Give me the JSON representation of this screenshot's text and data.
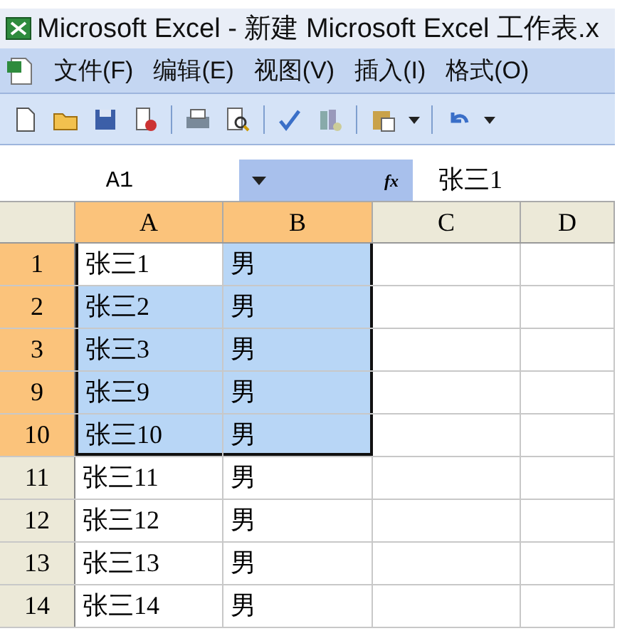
{
  "window": {
    "title": "Microsoft Excel - 新建 Microsoft Excel 工作表.x"
  },
  "menu": [
    {
      "label": "文件(F)"
    },
    {
      "label": "编辑(E)"
    },
    {
      "label": "视图(V)"
    },
    {
      "label": "插入(I)"
    },
    {
      "label": "格式(O)"
    }
  ],
  "toolbar": [
    {
      "kind": "new"
    },
    {
      "kind": "open"
    },
    {
      "kind": "save"
    },
    {
      "kind": "permission"
    },
    {
      "kind": "sep"
    },
    {
      "kind": "print"
    },
    {
      "kind": "preview"
    },
    {
      "kind": "sep"
    },
    {
      "kind": "spelling"
    },
    {
      "kind": "research"
    },
    {
      "kind": "sep"
    },
    {
      "kind": "paste"
    },
    {
      "kind": "dropdown"
    },
    {
      "kind": "sep"
    },
    {
      "kind": "undo"
    },
    {
      "kind": "dropdown"
    }
  ],
  "formula_bar": {
    "name_box": "A1",
    "fx": "fx",
    "value": "张三1"
  },
  "columns": [
    {
      "label": "A",
      "selected": true
    },
    {
      "label": "B",
      "selected": true
    },
    {
      "label": "C",
      "selected": false
    },
    {
      "label": "D",
      "selected": false
    }
  ],
  "rows": [
    {
      "header": "1",
      "selected": true,
      "cells": [
        {
          "text": "张三1",
          "active": true
        },
        {
          "text": "男",
          "active": false
        }
      ]
    },
    {
      "header": "2",
      "selected": true,
      "cells": [
        {
          "text": "张三2",
          "active": false
        },
        {
          "text": "男",
          "active": false
        }
      ]
    },
    {
      "header": "3",
      "selected": true,
      "cells": [
        {
          "text": "张三3",
          "active": false
        },
        {
          "text": "男",
          "active": false
        }
      ]
    },
    {
      "header": "9",
      "selected": true,
      "cells": [
        {
          "text": "张三9",
          "active": false
        },
        {
          "text": "男",
          "active": false
        }
      ]
    },
    {
      "header": "10",
      "selected": true,
      "cells": [
        {
          "text": "张三10",
          "active": false
        },
        {
          "text": "男",
          "active": false
        }
      ]
    },
    {
      "header": "11",
      "selected": false,
      "cells": [
        {
          "text": "张三11",
          "active": false
        },
        {
          "text": "男",
          "active": false
        }
      ]
    },
    {
      "header": "12",
      "selected": false,
      "cells": [
        {
          "text": "张三12",
          "active": false
        },
        {
          "text": "男",
          "active": false
        }
      ]
    },
    {
      "header": "13",
      "selected": false,
      "cells": [
        {
          "text": "张三13",
          "active": false
        },
        {
          "text": "男",
          "active": false
        }
      ]
    },
    {
      "header": "14",
      "selected": false,
      "cells": [
        {
          "text": "张三14",
          "active": false
        },
        {
          "text": "男",
          "active": false
        }
      ]
    }
  ]
}
